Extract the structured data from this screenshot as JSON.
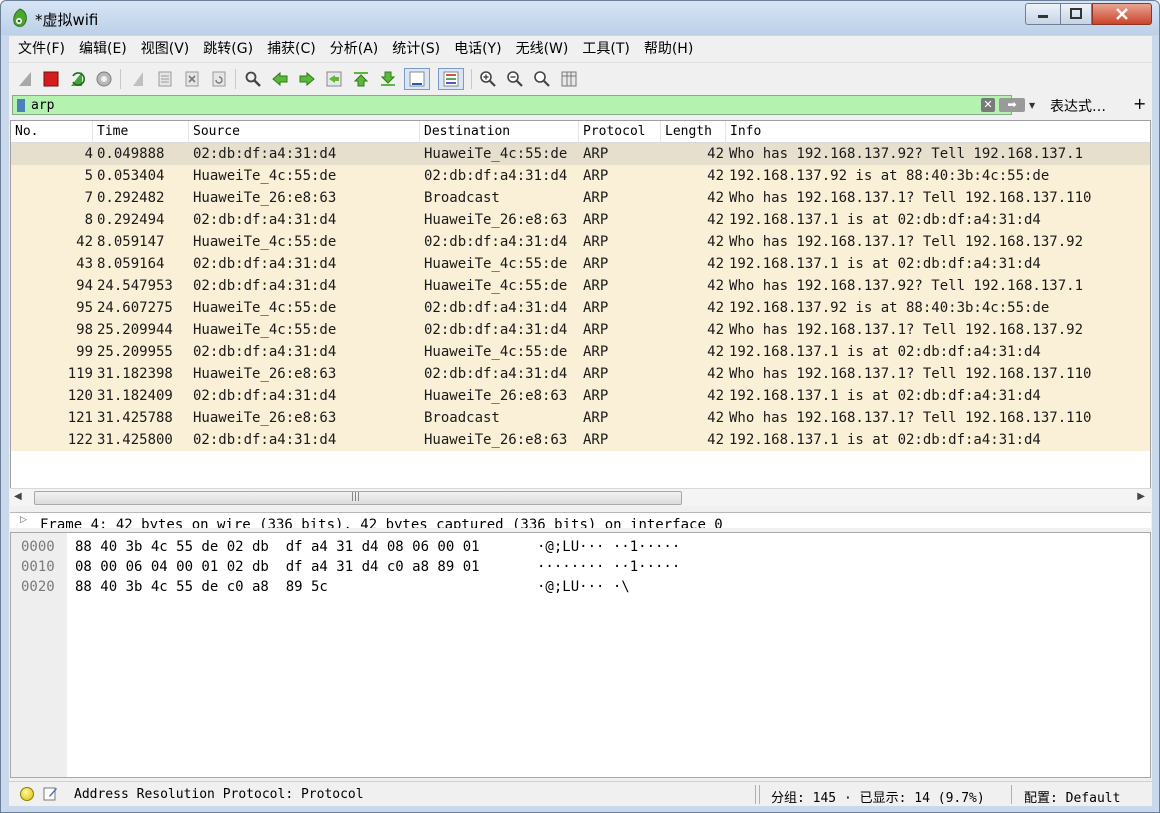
{
  "window": {
    "title": "*虚拟wifi"
  },
  "menu": [
    "文件(F)",
    "编辑(E)",
    "视图(V)",
    "跳转(G)",
    "捕获(C)",
    "分析(A)",
    "统计(S)",
    "电话(Y)",
    "无线(W)",
    "工具(T)",
    "帮助(H)"
  ],
  "toolbar": {
    "icons": [
      "shark-fin-start-icon",
      "stop-capture-icon",
      "restart-capture-icon",
      "capture-options-icon",
      "open-file-icon",
      "save-file-icon",
      "close-file-icon",
      "reload-file-icon",
      "find-packet-icon",
      "go-back-icon",
      "go-forward-icon",
      "go-to-packet-icon",
      "go-first-icon",
      "go-last-icon",
      "auto-scroll-icon",
      "colorize-icon",
      "zoom-in-icon",
      "zoom-out-icon",
      "zoom-normal-icon",
      "resize-columns-icon"
    ]
  },
  "filter": {
    "value": "arp",
    "expression_label": "表达式…",
    "plus": "+"
  },
  "packet_list": {
    "columns": [
      "No.",
      "Time",
      "Source",
      "Destination",
      "Protocol",
      "Length",
      "Info"
    ],
    "rows": [
      {
        "no": "4",
        "time": "0.049888",
        "src": "02:db:df:a4:31:d4",
        "dst": "HuaweiTe_4c:55:de",
        "proto": "ARP",
        "len": "42",
        "info": "Who has 192.168.137.92? Tell 192.168.137.1"
      },
      {
        "no": "5",
        "time": "0.053404",
        "src": "HuaweiTe_4c:55:de",
        "dst": "02:db:df:a4:31:d4",
        "proto": "ARP",
        "len": "42",
        "info": "192.168.137.92 is at 88:40:3b:4c:55:de"
      },
      {
        "no": "7",
        "time": "0.292482",
        "src": "HuaweiTe_26:e8:63",
        "dst": "Broadcast",
        "proto": "ARP",
        "len": "42",
        "info": "Who has 192.168.137.1? Tell 192.168.137.110"
      },
      {
        "no": "8",
        "time": "0.292494",
        "src": "02:db:df:a4:31:d4",
        "dst": "HuaweiTe_26:e8:63",
        "proto": "ARP",
        "len": "42",
        "info": "192.168.137.1 is at 02:db:df:a4:31:d4"
      },
      {
        "no": "42",
        "time": "8.059147",
        "src": "HuaweiTe_4c:55:de",
        "dst": "02:db:df:a4:31:d4",
        "proto": "ARP",
        "len": "42",
        "info": "Who has 192.168.137.1? Tell 192.168.137.92"
      },
      {
        "no": "43",
        "time": "8.059164",
        "src": "02:db:df:a4:31:d4",
        "dst": "HuaweiTe_4c:55:de",
        "proto": "ARP",
        "len": "42",
        "info": "192.168.137.1 is at 02:db:df:a4:31:d4"
      },
      {
        "no": "94",
        "time": "24.547953",
        "src": "02:db:df:a4:31:d4",
        "dst": "HuaweiTe_4c:55:de",
        "proto": "ARP",
        "len": "42",
        "info": "Who has 192.168.137.92? Tell 192.168.137.1"
      },
      {
        "no": "95",
        "time": "24.607275",
        "src": "HuaweiTe_4c:55:de",
        "dst": "02:db:df:a4:31:d4",
        "proto": "ARP",
        "len": "42",
        "info": "192.168.137.92 is at 88:40:3b:4c:55:de"
      },
      {
        "no": "98",
        "time": "25.209944",
        "src": "HuaweiTe_4c:55:de",
        "dst": "02:db:df:a4:31:d4",
        "proto": "ARP",
        "len": "42",
        "info": "Who has 192.168.137.1? Tell 192.168.137.92"
      },
      {
        "no": "99",
        "time": "25.209955",
        "src": "02:db:df:a4:31:d4",
        "dst": "HuaweiTe_4c:55:de",
        "proto": "ARP",
        "len": "42",
        "info": "192.168.137.1 is at 02:db:df:a4:31:d4"
      },
      {
        "no": "119",
        "time": "31.182398",
        "src": "HuaweiTe_26:e8:63",
        "dst": "02:db:df:a4:31:d4",
        "proto": "ARP",
        "len": "42",
        "info": "Who has 192.168.137.1? Tell 192.168.137.110"
      },
      {
        "no": "120",
        "time": "31.182409",
        "src": "02:db:df:a4:31:d4",
        "dst": "HuaweiTe_26:e8:63",
        "proto": "ARP",
        "len": "42",
        "info": "192.168.137.1 is at 02:db:df:a4:31:d4"
      },
      {
        "no": "121",
        "time": "31.425788",
        "src": "HuaweiTe_26:e8:63",
        "dst": "Broadcast",
        "proto": "ARP",
        "len": "42",
        "info": "Who has 192.168.137.1? Tell 192.168.137.110"
      },
      {
        "no": "122",
        "time": "31.425800",
        "src": "02:db:df:a4:31:d4",
        "dst": "HuaweiTe_26:e8:63",
        "proto": "ARP",
        "len": "42",
        "info": "192.168.137.1 is at 02:db:df:a4:31:d4"
      }
    ]
  },
  "details": {
    "line": "Frame 4: 42 bytes on wire (336 bits), 42 bytes captured (336 bits) on interface 0"
  },
  "bytes": [
    {
      "offset": "0000",
      "hex": "88 40 3b 4c 55 de 02 db  df a4 31 d4 08 06 00 01",
      "ascii": "·@;LU··· ··1·····"
    },
    {
      "offset": "0010",
      "hex": "08 00 06 04 00 01 02 db  df a4 31 d4 c0 a8 89 01",
      "ascii": "········ ··1·····"
    },
    {
      "offset": "0020",
      "hex": "88 40 3b 4c 55 de c0 a8  89 5c",
      "ascii": "·@;LU··· ·\\"
    }
  ],
  "status": {
    "field_text": "Address Resolution Protocol: Protocol",
    "packets_text": "分组: 145 · 已显示: 14 (9.7%)",
    "profile_text": "配置: Default"
  },
  "colors": {
    "filter_valid": "#b4f2b0",
    "row_bg": "#faf0d7",
    "row_selected": "#e6dfcd"
  }
}
